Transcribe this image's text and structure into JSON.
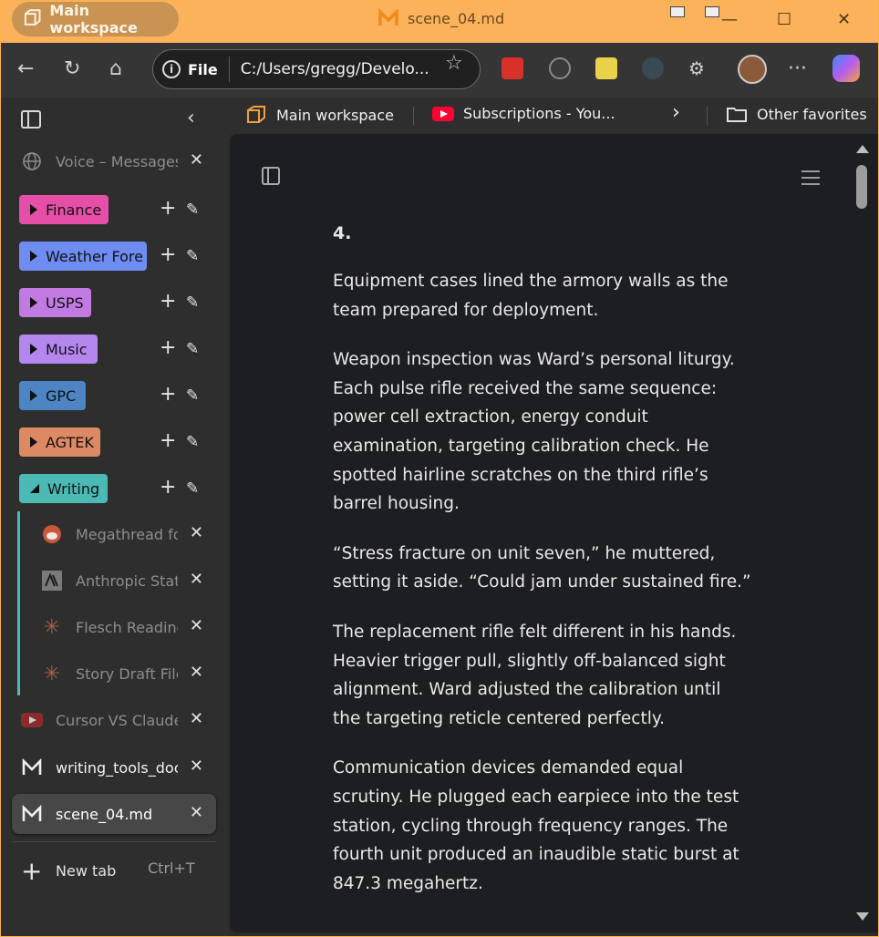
{
  "titlebar": {
    "workspace_label": "Main workspace",
    "file_title": "scene_04.md",
    "minimize": "—",
    "maximize": "☐",
    "close": "✕"
  },
  "navbar": {
    "back": "←",
    "refresh": "↻",
    "home": "⌂",
    "site_info_label": "File",
    "address": "C:/Users/gregg/Develo...",
    "favorite_icon": "star-icon",
    "more": "···"
  },
  "favorites": {
    "items": [
      {
        "label": "Main workspace",
        "icon": "workspace-icon"
      },
      {
        "label": "Subscriptions - You...",
        "icon": "youtube-icon"
      }
    ],
    "overflow": "›",
    "other": "Other favorites"
  },
  "sidebar": {
    "collapse": "‹",
    "tabs_top": [
      {
        "label": "Voice – Messages",
        "icon": "globe-icon"
      }
    ],
    "groups": [
      {
        "label": "Finance",
        "color": "#e64fa8",
        "open": false
      },
      {
        "label": "Weather Fore",
        "color": "#6e8cf2",
        "open": false
      },
      {
        "label": "USPS",
        "color": "#c27ae3",
        "open": false
      },
      {
        "label": "Music",
        "color": "#b487ef",
        "open": false
      },
      {
        "label": "GPC",
        "color": "#4c84c4",
        "open": false
      },
      {
        "label": "AGTEK",
        "color": "#dd8a64",
        "open": false
      },
      {
        "label": "Writing",
        "color": "#4bbab5",
        "open": true
      }
    ],
    "writing_tabs": [
      {
        "label": "Megathread fo",
        "icon": "reddit-icon"
      },
      {
        "label": "Anthropic Statu",
        "icon": "anthropic-icon"
      },
      {
        "label": "Flesch Reading",
        "icon": "claude-icon"
      },
      {
        "label": "Story Draft File",
        "icon": "claude-icon"
      }
    ],
    "other_tabs": [
      {
        "label": "Cursor VS Claude",
        "icon": "youtube-icon"
      },
      {
        "label": "writing_tools_doc",
        "icon": "markdown-icon"
      },
      {
        "label": "scene_04.md",
        "icon": "markdown-icon",
        "active": true
      }
    ],
    "new_tab_label": "New tab",
    "new_tab_shortcut": "Ctrl+T",
    "close_glyph": "✕",
    "plus_glyph": "+",
    "pen_glyph": "✎"
  },
  "document": {
    "heading": "4.",
    "paragraphs": [
      "Equipment cases lined the armory walls as the team prepared for deployment.",
      "Weapon inspection was Ward’s personal liturgy. Each pulse rifle received the same sequence: power cell extraction, energy conduit examination, targeting calibration check. He spotted hairline scratches on the third rifle’s barrel housing.",
      "“Stress fracture on unit seven,” he muttered, setting it aside. “Could jam under sustained fire.”",
      "The replacement rifle felt different in his hands. Heavier trigger pull, slightly off-balanced sight alignment. Ward adjusted the calibration until the targeting reticle centered perfectly.",
      "Communication devices demanded equal scrutiny. He plugged each earpiece into the test station, cycling through frequency ranges. The fourth unit produced an inaudible static burst at 847.3 megahertz."
    ]
  }
}
